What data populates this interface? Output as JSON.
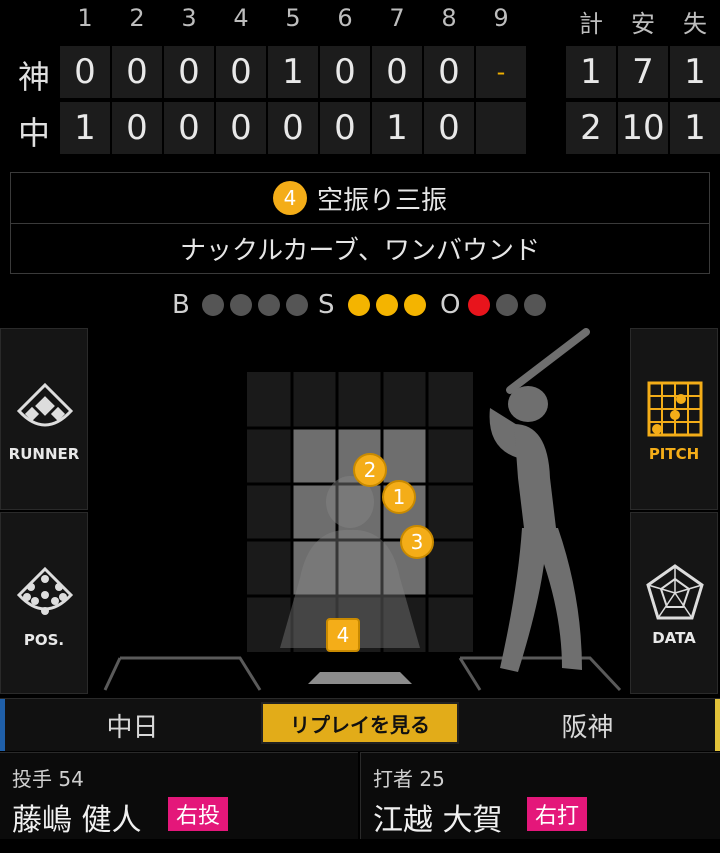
{
  "scoreboard": {
    "innings": [
      "1",
      "2",
      "3",
      "4",
      "5",
      "6",
      "7",
      "8",
      "9"
    ],
    "totals_headers": [
      "計",
      "安",
      "失"
    ],
    "teams": [
      {
        "name": "神",
        "scores": [
          "0",
          "0",
          "0",
          "0",
          "1",
          "0",
          "0",
          "0",
          "-"
        ],
        "totals": [
          "1",
          "7",
          "1"
        ]
      },
      {
        "name": "中",
        "scores": [
          "1",
          "0",
          "0",
          "0",
          "0",
          "0",
          "1",
          "0",
          ""
        ],
        "totals": [
          "2",
          "10",
          "1"
        ]
      }
    ]
  },
  "play": {
    "pitch_number": "4",
    "result": "空振り三振",
    "detail": "ナックルカーブ、ワンバウンド"
  },
  "count": {
    "balls_label": "B",
    "strikes_label": "S",
    "outs_label": "O",
    "balls": 0,
    "strikes": 3,
    "outs": 1
  },
  "side_buttons": {
    "runner": "RUNNER",
    "pos": "POS.",
    "pitch": "PITCH",
    "data": "DATA"
  },
  "pitches": [
    {
      "n": "1"
    },
    {
      "n": "2"
    },
    {
      "n": "3"
    },
    {
      "n": "4"
    }
  ],
  "tabs": {
    "home": "中日",
    "replay": "リプレイを見る",
    "away": "阪神"
  },
  "pitcher": {
    "role": "投手",
    "number": "54",
    "name": "藤嶋 健人",
    "hand": "右投"
  },
  "batter": {
    "role": "打者",
    "number": "25",
    "name": "江越 大賀",
    "hand": "右打"
  },
  "colors": {
    "accent": "#f4ad18",
    "strike_dot": "#f4b400",
    "out_dot": "#e8141c",
    "hand_badge": "#e4177a"
  }
}
